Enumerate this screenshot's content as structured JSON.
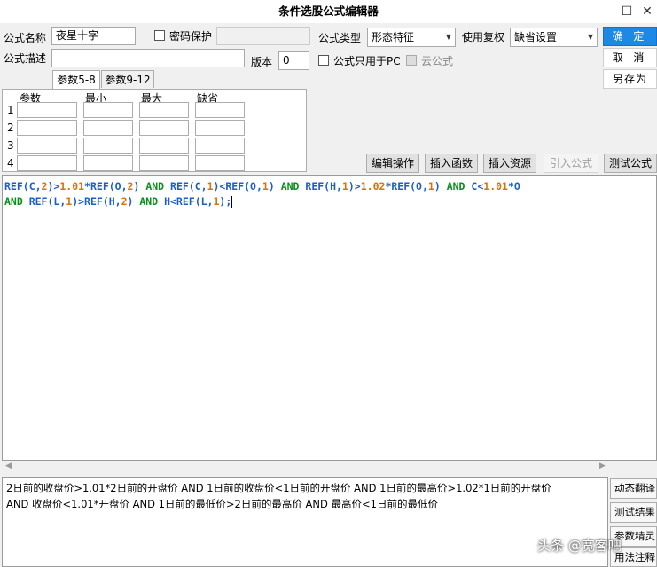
{
  "window": {
    "title": "条件选股公式编辑器",
    "restore_glyph": "☐",
    "close_glyph": "✕"
  },
  "form": {
    "name_label": "公式名称",
    "name_value": "夜星十字",
    "password_label": "密码保护",
    "type_label": "公式类型",
    "type_value": "形态特征",
    "restore_label": "使用复权",
    "restore_value": "缺省设置",
    "desc_label": "公式描述",
    "desc_value": "",
    "version_label": "版本",
    "version_value": "0",
    "pc_only_label": "公式只用于PC",
    "cloud_label": "云公式"
  },
  "buttons": {
    "ok": "确 定",
    "cancel": "取 消",
    "save_as": "另存为",
    "edit_ops": "编辑操作",
    "insert_func": "插入函数",
    "insert_res": "插入资源",
    "import_formula": "引入公式",
    "test_formula": "测试公式"
  },
  "tabs": [
    "参数5-8",
    "参数9-12"
  ],
  "params": {
    "headers": [
      "参数",
      "最小",
      "最大",
      "缺省"
    ],
    "rows": [
      "1",
      "2",
      "3",
      "4"
    ]
  },
  "code": {
    "line1": [
      [
        "k",
        "REF(C,"
      ],
      [
        "n",
        "2"
      ],
      [
        "k",
        ")>"
      ],
      [
        "n",
        "1.01"
      ],
      [
        "k",
        "*REF(O,"
      ],
      [
        "n",
        "2"
      ],
      [
        "k",
        ") "
      ],
      [
        "a",
        "AND"
      ],
      [
        "k",
        " REF(C,"
      ],
      [
        "n",
        "1"
      ],
      [
        "k",
        ")<REF(O,"
      ],
      [
        "n",
        "1"
      ],
      [
        "k",
        ") "
      ],
      [
        "a",
        "AND"
      ],
      [
        "k",
        " REF(H,"
      ],
      [
        "n",
        "1"
      ],
      [
        "k",
        ")>"
      ],
      [
        "n",
        "1.02"
      ],
      [
        "k",
        "*REF(O,"
      ],
      [
        "n",
        "1"
      ],
      [
        "k",
        ") "
      ],
      [
        "a",
        "AND"
      ],
      [
        "k",
        " C<"
      ],
      [
        "n",
        "1.01"
      ],
      [
        "k",
        "*O"
      ]
    ],
    "line2": [
      [
        "a",
        "AND"
      ],
      [
        "k",
        " REF(L,"
      ],
      [
        "n",
        "1"
      ],
      [
        "k",
        ")>REF(H,"
      ],
      [
        "n",
        "2"
      ],
      [
        "k",
        ") "
      ],
      [
        "a",
        "AND"
      ],
      [
        "k",
        " H<REF(L,"
      ],
      [
        "n",
        "1"
      ],
      [
        "k",
        ");"
      ]
    ]
  },
  "translation": {
    "line1": "2日前的收盘价>1.01*2日前的开盘价 AND 1日前的收盘价<1日前的开盘价 AND 1日前的最高价>1.02*1日前的开盘价",
    "line2": "AND 收盘价<1.01*开盘价 AND 1日前的最低价>2日前的最高价 AND 最高价<1日前的最低价"
  },
  "side_buttons": [
    "动态翻译",
    "测试结果",
    "参数精灵",
    "用法注释"
  ],
  "watermark": "头条 @宽客吧"
}
